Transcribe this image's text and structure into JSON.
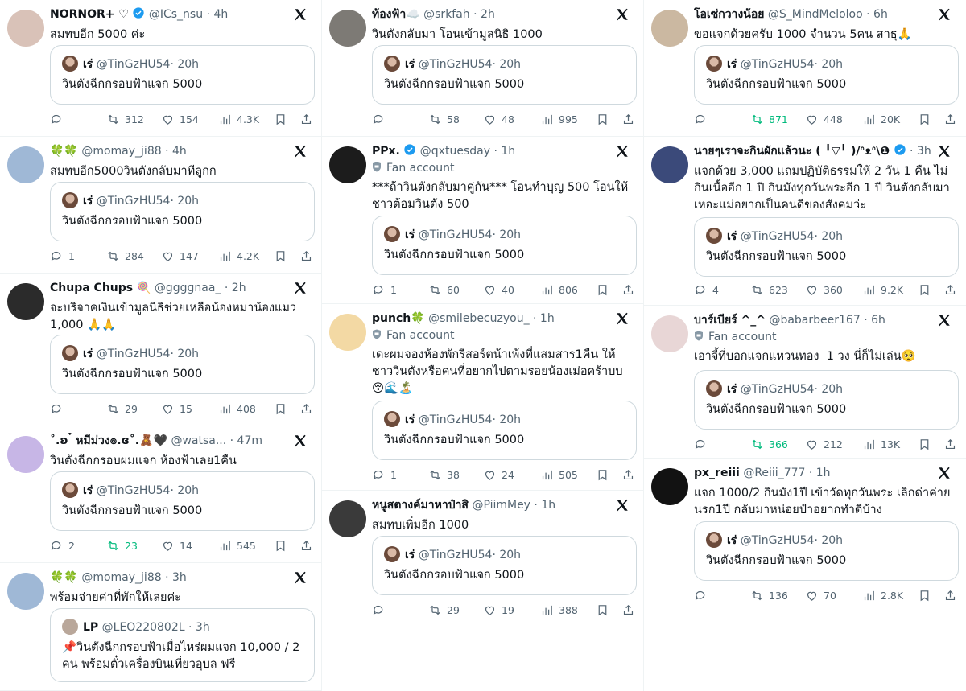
{
  "quoted_default": {
    "name": "เร่",
    "handle": "@TinGzHU54",
    "time": "· 20h",
    "text": "วินตังฉีกกรอบฟ้าแจก 5000"
  },
  "columns": [
    [
      {
        "name": "NORNOR+ ♡",
        "verified": true,
        "handle": "@ICs_nsu",
        "time": "· 4h",
        "text": "สมทบอีก 5000 ค่ะ",
        "fan_account": "",
        "quote": "default",
        "reply": "",
        "retweet": "312",
        "like": "154",
        "views": "4.3K",
        "retweet_active": false,
        "avatar_color": "#d9c2b8"
      },
      {
        "name": "🍀🍀",
        "verified": false,
        "handle": "@momay_ji88",
        "time": "· 4h",
        "text": "สมทบอีก5000วินตังกลับมาทีลูกก",
        "fan_account": "",
        "quote": "default",
        "reply": "1",
        "retweet": "284",
        "like": "147",
        "views": "4.2K",
        "retweet_active": false,
        "avatar_color": "#9fb8d6"
      },
      {
        "name": "Chupa Chups 🍭",
        "verified": false,
        "handle": "@ggggnaa_",
        "time": "· 2h",
        "text": "จะบริจาคเงินเข้ามูลนิธิช่วยเหลือน้องหมาน้องแมว 1,000 🙏🙏",
        "fan_account": "",
        "quote": "default",
        "reply": "",
        "retweet": "29",
        "like": "15",
        "views": "408",
        "retweet_active": false,
        "avatar_color": "#2b2b2b"
      },
      {
        "name": "˚.ʚ ๋ หมีม่วง๏.ɞ˚.🧸🖤",
        "verified": false,
        "handle": "@watsa...",
        "time": "· 47m",
        "text": "วินตังฉีกกรอบผมแจก ห้องฟ้าเลย1คืน",
        "fan_account": "",
        "quote": "default",
        "reply": "2",
        "retweet": "23",
        "like": "14",
        "views": "545",
        "retweet_active": true,
        "avatar_color": "#c7b6e6"
      },
      {
        "name": "🍀🍀",
        "verified": false,
        "handle": "@momay_ji88",
        "time": "· 3h",
        "text": "พร้อมจ่ายค่าที่พักให้เลยค่ะ",
        "fan_account": "",
        "quote": "lp",
        "reply": "",
        "retweet": "",
        "like": "",
        "views": "",
        "retweet_active": false,
        "avatar_color": "#9fb8d6"
      }
    ],
    [
      {
        "name": "ท้องฟ้า☁️",
        "verified": false,
        "handle": "@srkfah",
        "time": "· 2h",
        "text": "วินตังกลับมา โอนเข้ามูลนิธิ 1000",
        "fan_account": "",
        "quote": "default",
        "reply": "",
        "retweet": "58",
        "like": "48",
        "views": "995",
        "retweet_active": false,
        "avatar_color": "#7d7a75"
      },
      {
        "name": "PPx.",
        "verified": true,
        "handle": "@qxtuesday",
        "time": "· 1h",
        "text": "***ถ้าวินตังกลับมาคู่กัน*** โอนทำบุญ 500 โอนให้ชาวต้อมวินตัง 500",
        "fan_account": "Fan account",
        "quote": "default",
        "reply": "1",
        "retweet": "60",
        "like": "40",
        "views": "806",
        "retweet_active": false,
        "avatar_color": "#1c1c1c"
      },
      {
        "name": "punch🍀",
        "verified": false,
        "handle": "@smilebecuzyou_",
        "time": "· 1h",
        "text": "เดะผมจองห้องพักรีสอร์ตน้าเพ้งที่แสมสาร1คืน ให้ชาววินตังหรือคนที่อยากไปตามรอยน้องเม่อคร้าบบ 😚🌊🏝️",
        "fan_account": "Fan account",
        "quote": "default",
        "reply": "1",
        "retweet": "38",
        "like": "24",
        "views": "505",
        "retweet_active": false,
        "avatar_color": "#f3d9a4"
      },
      {
        "name": "หนูสตางค์มาหาป๋าสิ",
        "verified": false,
        "handle": "@PiimMey",
        "time": "· 1h",
        "text": "สมทบเพิ่มอีก 1000",
        "fan_account": "",
        "quote": "default",
        "reply": "",
        "retweet": "29",
        "like": "19",
        "views": "388",
        "retweet_active": false,
        "avatar_color": "#3a3a3a"
      }
    ],
    [
      {
        "name": "โอเซ่กวางน้อย",
        "verified": false,
        "handle": "@S_MindMeloloo",
        "time": "· 6h",
        "text": "ขอแจกด้วยครับ 1000 จำนวน 5คน สาธุ🙏",
        "fan_account": "",
        "quote": "default",
        "reply": "",
        "retweet": "871",
        "like": "448",
        "views": "20K",
        "retweet_active": true,
        "avatar_color": "#cbb8a1"
      },
      {
        "name": "นายๆเราจะกินผักแล้วนะ (⁠ ⁠╹⁠▽⁠╹⁠ ⁠)⁠/ᐢ⁠ᴥ⁠ᐢ⁠\\❶",
        "verified": true,
        "handle": "",
        "time": "· 3h",
        "text": "แจกด้วย 3,000 แถมปฏิบัติธรรมให้ 2 วัน 1 คืน ไม่กินเนื้ออีก 1 ปี กินมังทุกวันพระอีก 1 ปี วินตังกลับมาเหอะแม่อยากเป็นคนดีของสังคมว่ะ",
        "fan_account": "",
        "quote": "default",
        "reply": "4",
        "retweet": "623",
        "like": "360",
        "views": "9.2K",
        "retweet_active": false,
        "avatar_color": "#3b4a7a"
      },
      {
        "name": "บาร์เบียร์ ^_^",
        "verified": false,
        "handle": "@babarbeer167",
        "time": "· 6h",
        "text": "เอาจี้ที่บอกแจกแหวนทอง  1 วง นี่ก็ไม่เล่น🥺",
        "fan_account": "Fan account",
        "quote": "default",
        "reply": "",
        "retweet": "366",
        "like": "212",
        "views": "13K",
        "retweet_active": true,
        "avatar_color": "#e8d6d6"
      },
      {
        "name": "px_reiii",
        "verified": false,
        "handle": "@Reiii_777",
        "time": "· 1h",
        "text": "แจก 1000/2 กินมัง1ปี เข้าวัดทุกวันพระ เลิกด่าค่ายนรก1ปี กลับมาหน่อยป๋าอยากทำดีบ้าง",
        "fan_account": "",
        "quote": "default",
        "reply": "",
        "retweet": "136",
        "like": "70",
        "views": "2.8K",
        "retweet_active": false,
        "avatar_color": "#121212"
      }
    ]
  ],
  "lp_quote": {
    "name": "LP",
    "handle": "@LEO220802L",
    "time": "· 3h",
    "text": "📌วินตังฉีกกรอบฟ้าเมื่อไหร่ผมแจก 10,000 / 2 คน พร้อมตั๋วเครื่องบินเที่ยวอุบล ฟรี"
  },
  "colors": {
    "x_logo": "#0f1419",
    "verified": "#1d9bf0",
    "muted": "#536471",
    "green": "#00ba7c",
    "border": "#cfd9de"
  }
}
